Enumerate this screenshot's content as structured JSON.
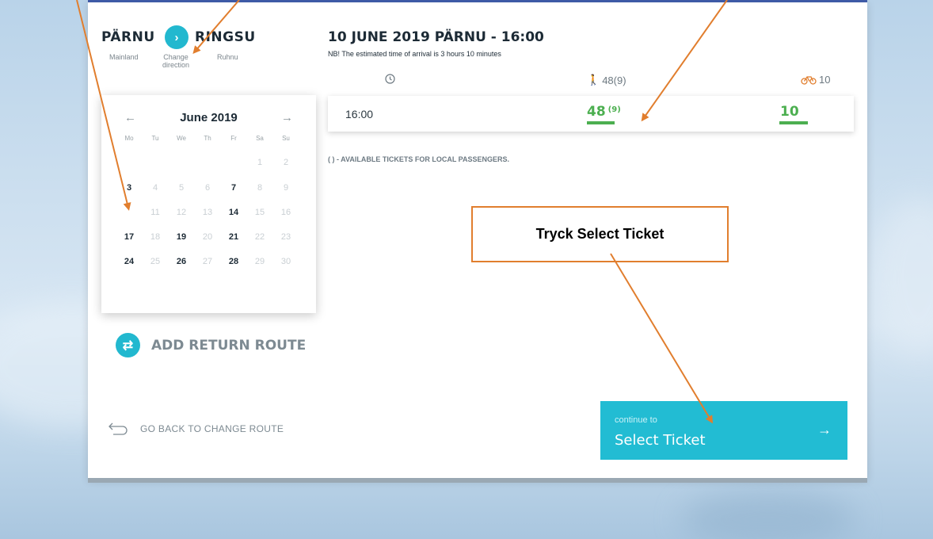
{
  "route": {
    "from_name": "PÄRNU",
    "from_sub": "Mainland",
    "change_label": "Change direction",
    "to_name": "RINGSU",
    "to_sub": "Ruhnu"
  },
  "trip": {
    "title": "10 JUNE 2019 PÄRNU - 16:00",
    "note": "NB! The estimated time of arrival is 3 hours 10 minutes"
  },
  "columns": {
    "passengers": "48(9)",
    "bikes": "10"
  },
  "departures": [
    {
      "time": "16:00",
      "passengers": "48",
      "passengers_local": "(9)",
      "bikes": "10"
    }
  ],
  "legend_note": "( ) - AVAILABLE TICKETS FOR LOCAL PASSENGERS.",
  "calendar": {
    "month_label": "June 2019",
    "prev": "←",
    "next": "→",
    "weekdays": [
      "Mo",
      "Tu",
      "We",
      "Th",
      "Fr",
      "Sa",
      "Su"
    ],
    "selected_day": "10",
    "days": [
      "1",
      "2",
      "3",
      "4",
      "5",
      "6",
      "7",
      "8",
      "9",
      "10",
      "11",
      "12",
      "13",
      "14",
      "15",
      "16",
      "17",
      "18",
      "19",
      "20",
      "21",
      "22",
      "23",
      "24",
      "25",
      "26",
      "27",
      "28",
      "29",
      "30"
    ],
    "available_days": [
      "3",
      "7",
      "10",
      "14",
      "17",
      "19",
      "21",
      "24",
      "26",
      "28"
    ]
  },
  "add_return_label": "ADD RETURN ROUTE",
  "go_back_label": "GO BACK TO CHANGE ROUTE",
  "continue": {
    "small": "continue to",
    "big": "Select Ticket",
    "arrow": "→"
  },
  "callout_text": "Tryck Select Ticket",
  "colors": {
    "accent": "#22bcd3",
    "selected_day": "#3f5ba8",
    "available_green": "#4caf50",
    "annotation_orange": "#e17e2e"
  }
}
